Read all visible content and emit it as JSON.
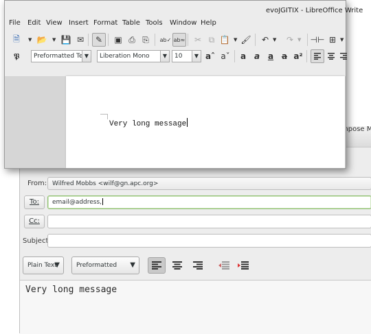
{
  "compose": {
    "title_partial": "mpose Me",
    "from_label": "From:",
    "from_value": "Wilfred Mobbs <wilf@gn.apc.org>",
    "to_label": "To:",
    "to_value": "email@address,",
    "cc_label": "Cc:",
    "cc_value": "",
    "subject_label": "Subject:",
    "subject_value": "",
    "format_select": "Plain Text",
    "style_select": "Preformatted",
    "body_text": "Very long message"
  },
  "writer": {
    "title": "evoJGITIX - LibreOffice Write",
    "menu": [
      "File",
      "Edit",
      "View",
      "Insert",
      "Format",
      "Table",
      "Tools",
      "Window",
      "Help"
    ],
    "paragraph_style": "Preformatted Tex",
    "font_name": "Liberation Mono",
    "font_size": "10",
    "document_text": "Very long message"
  },
  "colors": {
    "titlebar": "#ececec",
    "to_field_border": "#8fbf6f",
    "active_button": "#c9c9c9"
  }
}
